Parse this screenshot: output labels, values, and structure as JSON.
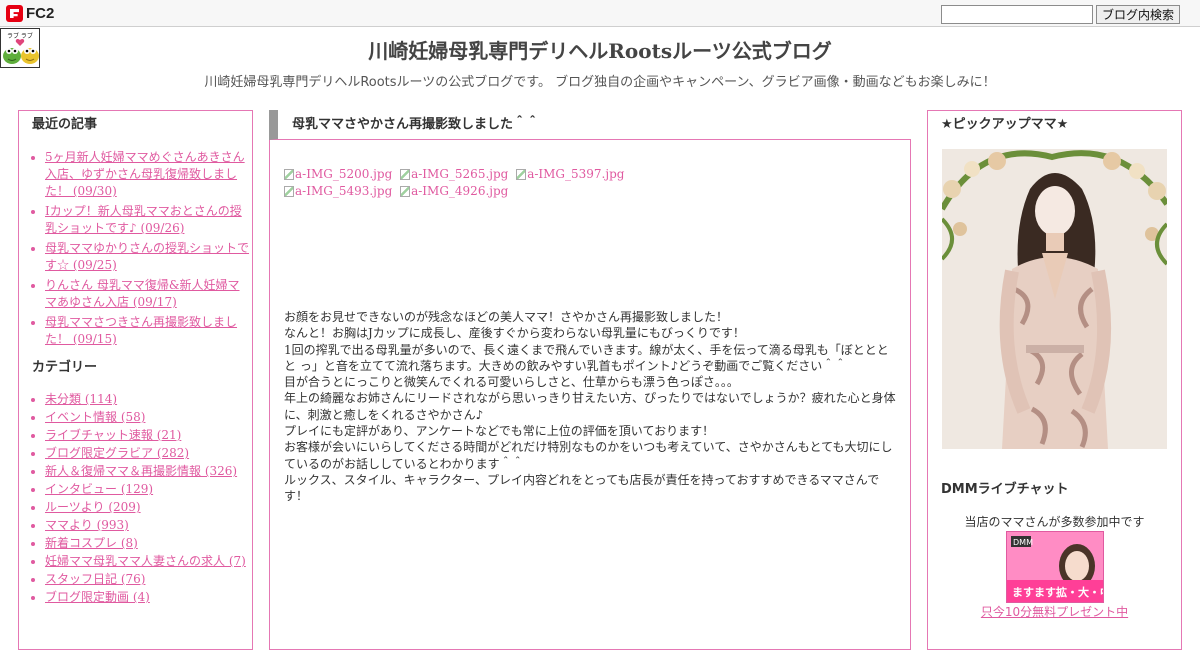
{
  "fc2bar": {
    "logo_text": "FC2",
    "search_placeholder": "",
    "search_button": "ブログ内検索"
  },
  "header": {
    "avatar_text": "ラブ ラブ",
    "title": "川崎妊婦母乳専門デリヘルRootsルーツ公式ブログ",
    "description": "川崎妊婦母乳専門デリヘルRootsルーツの公式ブログです。 ブログ独自の企画やキャンペーン、グラビア画像・動画などもお楽しみに！"
  },
  "left_sidebar": {
    "recent_heading": "最近の記事",
    "recent_posts": [
      "5ヶ月新人妊婦ママめぐさんあきさん入店、ゆずかさん母乳復帰致しました！ (09/30)",
      "Iカップ！新人母乳ママおとさんの授乳ショットです♪ (09/26)",
      "母乳ママゆかりさんの授乳ショットです☆ (09/25)",
      "りんさん 母乳ママ復帰&新人妊婦ママあゆさん入店 (09/17)",
      "母乳ママさつきさん再撮影致しました！ (09/15)"
    ],
    "category_heading": "カテゴリー",
    "categories": [
      "未分類 (114)",
      "イベント情報 (58)",
      "ライブチャット速報 (21)",
      "ブログ限定グラビア (282)",
      "新人＆復帰ママ＆再撮影情報 (326)",
      "インタビュー (129)",
      "ルーツより (209)",
      "ママより (993)",
      "新着コスプレ (8)",
      "妊婦ママ母乳ママ人妻さんの求人 (7)",
      "スタッフ日記 (76)",
      "ブログ限定動画 (4)"
    ]
  },
  "post": {
    "title": "母乳ママさやかさん再撮影致しました＾＾",
    "images_row1": [
      "a-IMG_5200.jpg",
      "a-IMG_5265.jpg",
      "a-IMG_5397.jpg"
    ],
    "images_row2": [
      "a-IMG_5493.jpg",
      "a-IMG_4926.jpg"
    ],
    "body": [
      "お顔をお見せできないのが残念なほどの美人ママ！さやかさん再撮影致しました！",
      "なんと！お胸はJカップに成長し、産後すぐから変わらない母乳量にもびっくりです！",
      "1回の搾乳で出る母乳量が多いので、長く遠くまで飛んでいきます。線が太く、手を伝って滴る母乳も「ぼとととと っ」と音を立てて流れ落ちます。大きめの飲みやすい乳首もポイント♪どうぞ動画でご覧ください＾＾",
      "目が合うとにっこりと微笑んでくれる可愛いらしさと、仕草からも漂う色っぽさ。。。",
      "年上の綺麗なお姉さんにリードされながら思いっきり甘えたい方、ぴったりではないでしょうか？疲れた心と身体に、刺激と癒しをくれるさやかさん♪",
      "プレイにも定評があり、アンケートなどでも常に上位の評価を頂いております！",
      "お客様が会いにいらしてくださる時間がどれだけ特別なものかをいつも考えていて、さやかさんもとても大切にしているのがお話ししているとわかります＾＾",
      "ルックス、スタイル、キャラクター、プレイ内容どれをとっても店長が責任を持っておすすめできるママさんです！"
    ]
  },
  "right_sidebar": {
    "pickup_heading": "★ピックアップママ★",
    "dmm_heading": "DMMライブチャット",
    "dmm_subtext": "当店のママさんが多数参加中です",
    "banner_top": "DMM",
    "banner_text": "ますます拡・大・中!!",
    "dmm_link": "只今10分無料プレゼント中"
  },
  "colors": {
    "accent_pink": "#e05aa0",
    "panel_border": "#e577b4",
    "title_bar_gray": "#999999"
  }
}
